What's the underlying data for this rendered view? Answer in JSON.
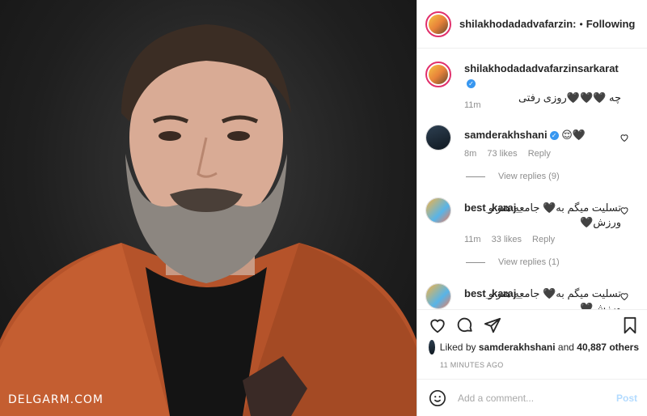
{
  "photo": {
    "watermark": "DELGARM.COM"
  },
  "header": {
    "username": "shilakhodadadvafarzin:",
    "separator": "•",
    "follow_label": "Following"
  },
  "caption": {
    "username": "shilakhodadadvafarzinsarkarat",
    "text": "چه 🖤🖤🖤روزی رفتی",
    "time": "11m"
  },
  "comments": [
    {
      "username": "samderakhshani",
      "verified": true,
      "text": "😌🖤",
      "time": "8m",
      "likes": "73 likes",
      "reply": "Reply",
      "view_replies": "View replies (9)"
    },
    {
      "username": "best_karaj_",
      "verified": false,
      "text": "تسلیت میگم به🖤 جامعه هنر و ورزش🖤",
      "time": "11m",
      "likes": "33 likes",
      "reply": "Reply",
      "view_replies": "View replies (1)"
    },
    {
      "username": "best_karaj_",
      "verified": false,
      "text": "تسلیت میگم به🖤 جامعه هنر و ورزش🖤"
    }
  ],
  "likes": {
    "prefix": "Liked by",
    "user": "samderakhshani",
    "middle": "and",
    "count": "40,887 others"
  },
  "timestamp": "11 MINUTES AGO",
  "add_comment": {
    "placeholder": "Add a comment...",
    "post_label": "Post"
  },
  "icons": [
    "heart-icon",
    "comment-icon",
    "share-icon",
    "bookmark-icon",
    "smiley-icon",
    "verified-icon"
  ],
  "colors": {
    "verified": "#3897f0",
    "post_disabled": "#b3dbff",
    "muted": "#8e8e8e"
  }
}
